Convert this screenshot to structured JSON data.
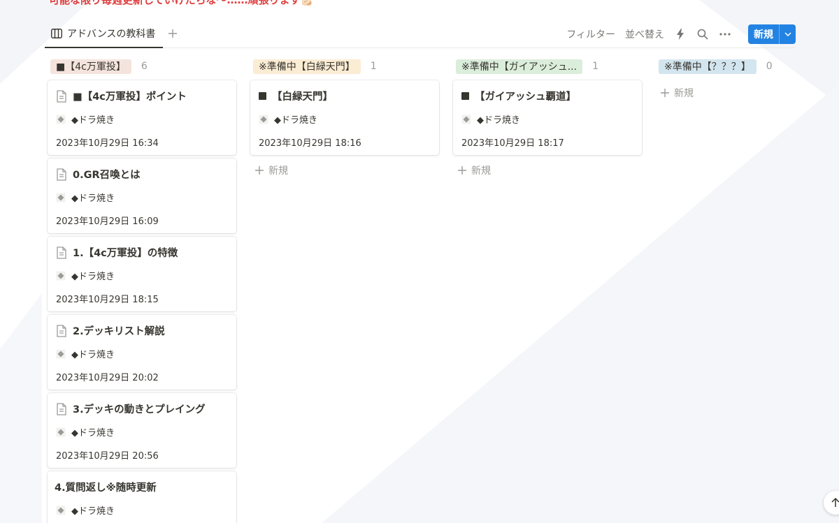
{
  "banner": {
    "text": "可能な限り毎週更新していけたらな〜……頑張ります💪🏻"
  },
  "view": {
    "tab_label": "アドバンスの教科書"
  },
  "toolbar": {
    "filter": "フィルター",
    "sort": "並べ替え",
    "new": "新規"
  },
  "board": {
    "columns": [
      {
        "label": "■【4c万軍投】",
        "count": "6",
        "tag_color": "#f4e4dd",
        "cards": [
          {
            "title": "■【4c万軍投】ポイント",
            "prop": "◆ドラ焼き",
            "date": "2023年10月29日 16:34"
          },
          {
            "title": "0.GR召喚とは",
            "prop": "◆ドラ焼き",
            "date": "2023年10月29日 16:09"
          },
          {
            "title": "1.【4c万軍投】の特徴",
            "prop": "◆ドラ焼き",
            "date": "2023年10月29日 18:15"
          },
          {
            "title": "2.デッキリスト解説",
            "prop": "◆ドラ焼き",
            "date": "2023年10月29日 20:02"
          },
          {
            "title": "3.デッキの動きとプレイング",
            "prop": "◆ドラ焼き",
            "date": "2023年10月29日 20:56"
          },
          {
            "title": "4.質問返し※随時更新",
            "prop": "◆ドラ焼き",
            "date": ""
          }
        ]
      },
      {
        "label": "※準備中【白緑天門】",
        "count": "1",
        "tag_color": "#fbecd4",
        "cards": [
          {
            "title": "【白緑天門】",
            "prop": "◆ドラ焼き",
            "date": "2023年10月29日 18:16"
          }
        ],
        "add_label": "新規"
      },
      {
        "label": "※準備中【ガイアッシュ...",
        "count": "1",
        "tag_color": "#dbeddb",
        "cards": [
          {
            "title": "【ガイアッシュ覇道】",
            "prop": "◆ドラ焼き",
            "date": "2023年10月29日 18:17"
          }
        ],
        "add_label": "新規"
      },
      {
        "label": "※準備中【？？？】",
        "count": "0",
        "tag_color": "#d3e5ef",
        "cards": [],
        "add_label": "新規"
      }
    ]
  }
}
